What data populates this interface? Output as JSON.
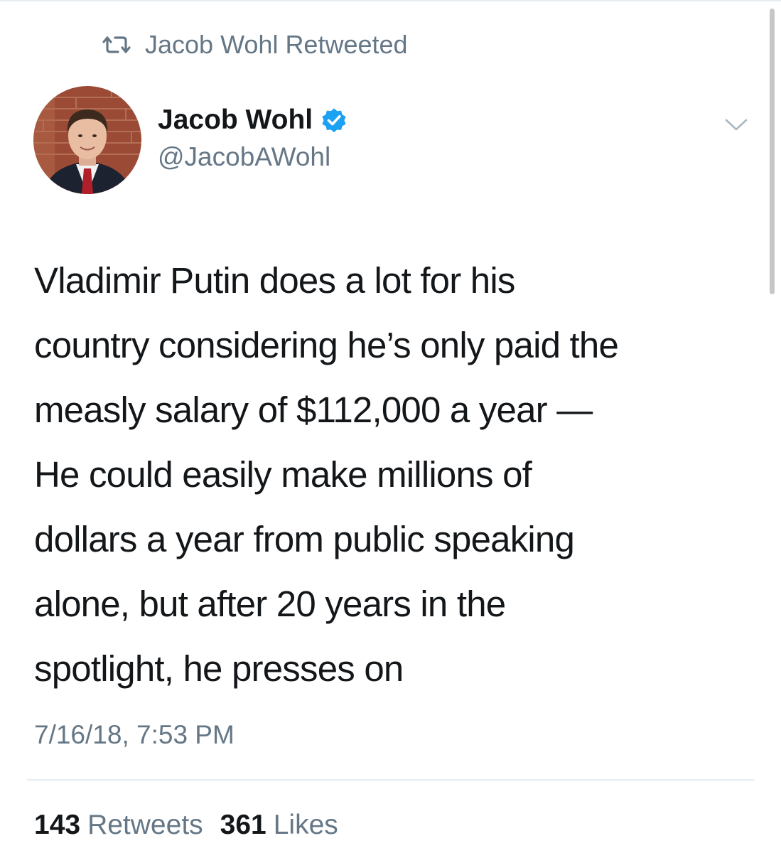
{
  "social_context": {
    "icon": "retweet-icon",
    "text": "Jacob Wohl Retweeted"
  },
  "author": {
    "avatar": "profile-photo",
    "display_name": "Jacob Wohl",
    "verified_icon": "verified-badge-icon",
    "handle": "@JacobAWohl"
  },
  "menu": {
    "icon": "chevron-down-icon"
  },
  "tweet": {
    "lines": [
      "Vladimir Putin does a lot for his",
      "country considering he’s only paid the",
      "measly salary of $112,000 a year —",
      "He could easily make millions of",
      "dollars a year from public speaking",
      "alone, but after 20 years in the",
      "spotlight, he presses on"
    ],
    "timestamp": "7/16/18, 7:53 PM"
  },
  "stats": {
    "retweets_count": "143",
    "retweets_label": "Retweets",
    "likes_count": "361",
    "likes_label": "Likes"
  },
  "colors": {
    "text_primary": "#14171a",
    "text_secondary": "#657786",
    "verified_blue": "#1da1f2",
    "divider": "#e6ecf0"
  }
}
